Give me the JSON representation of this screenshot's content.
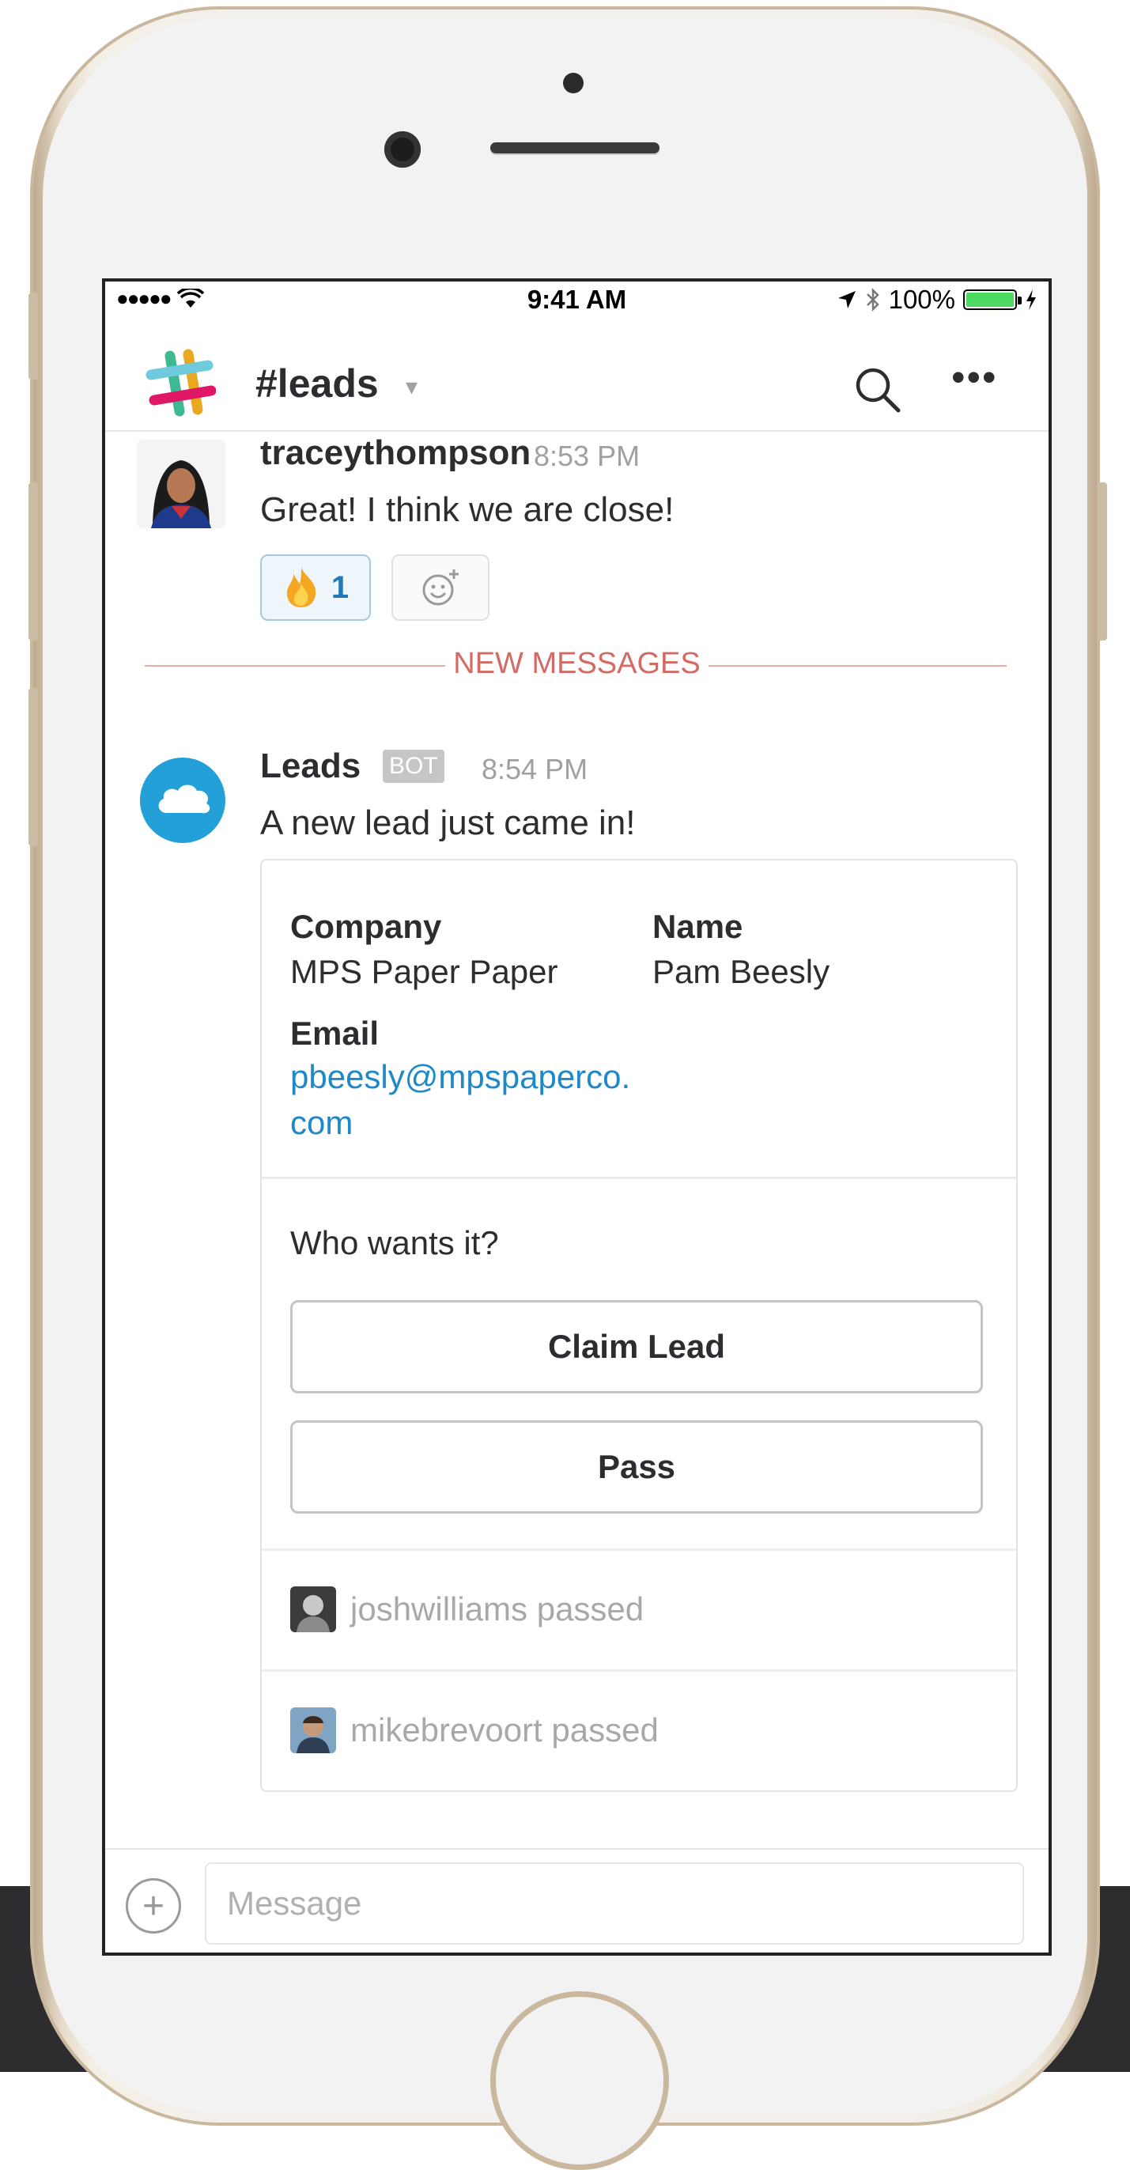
{
  "status_bar": {
    "signal": "●●●●●",
    "time": "9:41 AM",
    "battery": "100%",
    "battery_level": 1.0
  },
  "header": {
    "channel": "#leads",
    "caret": "▾"
  },
  "messages": [
    {
      "author": "traceythompson",
      "time": "8:53 PM",
      "text": "Great! I think we are close!",
      "reaction": {
        "emoji": "fire",
        "count": "1"
      }
    },
    {
      "author": "Leads",
      "badge": "BOT",
      "time": "8:54 PM",
      "text": "A new lead just came in!"
    }
  ],
  "divider": "NEW MESSAGES",
  "attachment": {
    "fields": [
      {
        "label": "Company",
        "value": "MPS Paper Paper"
      },
      {
        "label": "Name",
        "value": "Pam Beesly"
      },
      {
        "label": "Email",
        "value": "pbeesly@mpspaperco.com"
      }
    ],
    "question": "Who wants it?",
    "actions": [
      "Claim Lead",
      "Pass"
    ],
    "activity": [
      "joshwilliams passed",
      "mikebrevoort passed"
    ]
  },
  "composer": {
    "placeholder": "Message"
  },
  "colors": {
    "link": "#1e88c9",
    "divider": "#d46a63",
    "bot_avatar": "#23a0d8",
    "reaction_border": "#a3c9e6",
    "battery": "#4cd964"
  }
}
